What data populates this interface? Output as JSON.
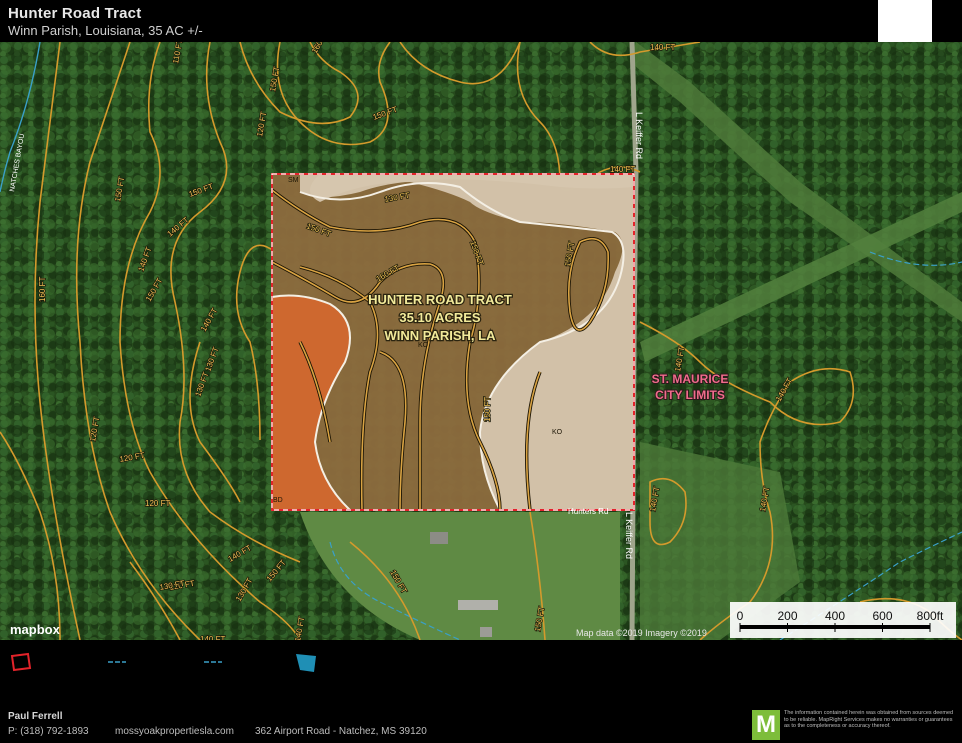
{
  "header": {
    "title": "Hunter Road Tract",
    "subtitle": "Winn Parish, Louisiana, 35 AC +/-"
  },
  "tract": {
    "label_line1": "HUNTER ROAD TRACT",
    "label_line2": "35.10 ACRES",
    "label_line3": "WINN PARISH, LA"
  },
  "city_limits": {
    "line1": "ST. MAURICE",
    "line2": "CITY LIMITS"
  },
  "roads": {
    "keiffer_top": "L Keiffer Rd",
    "keiffer_bottom": "L Keiffer Rd",
    "hunters": "Hunters Rd"
  },
  "bayou": "NATCHES BAYOU",
  "soil_codes": {
    "ko_center": "KO",
    "ko_right": "KO",
    "sm": "SM",
    "bd": "BD"
  },
  "contour_labels": [
    "160 FT",
    "150 FT",
    "140 FT",
    "130 FT",
    "120 FT",
    "110 FT",
    "150 FT",
    "140 FT",
    "130 FT",
    "120 FT",
    "150 FT",
    "160 FT",
    "150 FT",
    "140 FT",
    "150 FT",
    "140 FT",
    "130 FT",
    "120 FT",
    "120 FT",
    "150 FT",
    "160 FT",
    "150 FT",
    "150 FT",
    "150 FT",
    "140 FT",
    "150 FT",
    "130 FT",
    "120 FT",
    "150 FT",
    "140 FT",
    "140 FT",
    "140 FT",
    "150 FT",
    "140 FT",
    "140 FT",
    "140 FT",
    "130 FT",
    "140 FT"
  ],
  "scale": {
    "ticks": [
      "0",
      "200",
      "400",
      "600",
      "800ft"
    ]
  },
  "attribution": {
    "mapbox": "mapbox",
    "data": "Map data ©2019  Imagery ©2019"
  },
  "footer": {
    "name": "Paul Ferrell",
    "phone": "P: (318) 792-1893",
    "website": "mossyoakpropertiesla.com",
    "address": "362 Airport Road - Natchez, MS 39120",
    "logo_letter": "M",
    "disclaimer": "The information contained herein was obtained from sources deemed to be reliable. MapRight Services makes no warranties or guarantees as to the completeness or accuracy thereof."
  },
  "colors": {
    "boundary": "#e2232a",
    "contour": "#d49a2c",
    "soil_dark": "#8d6b3e",
    "soil_light": "#d6c6ae",
    "soil_orange": "#d2682e",
    "city_text": "#f06c8c",
    "water": "#3aa0c8"
  },
  "legend_icons": [
    "boundary-swatch-icon",
    "contour-line-icon",
    "contour-line-icon",
    "water-polygon-icon"
  ]
}
